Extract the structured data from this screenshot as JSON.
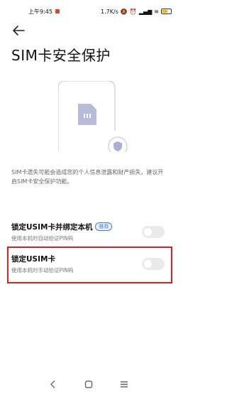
{
  "status_bar": {
    "time": "上午9:45",
    "network_speed": "1.7K/s",
    "battery_level": "45"
  },
  "header": {
    "back_icon": "arrow-left-icon",
    "title": "SIM卡安全保护"
  },
  "illustration": {
    "icon": "sim-card-shield-icon"
  },
  "description": "SIM卡遗失可能会造成您的个人信息泄露和财产损失，建议开启SIM卡安全保护功能。",
  "options": [
    {
      "title": "锁定USIM卡并绑定本机",
      "badge": "推荐",
      "subtitle": "使用本机时自动验证PIN码",
      "enabled": false
    },
    {
      "title": "锁定USIM卡",
      "subtitle": "使用本机时手动验证PIN码",
      "enabled": false
    }
  ],
  "nav_bar": {
    "back": "nav-back-icon",
    "home": "nav-home-icon",
    "recents": "nav-menu-icon"
  },
  "colors": {
    "highlight": "#e02020",
    "badge": "#3a7be8",
    "toggle_off": "#eaeaea"
  }
}
